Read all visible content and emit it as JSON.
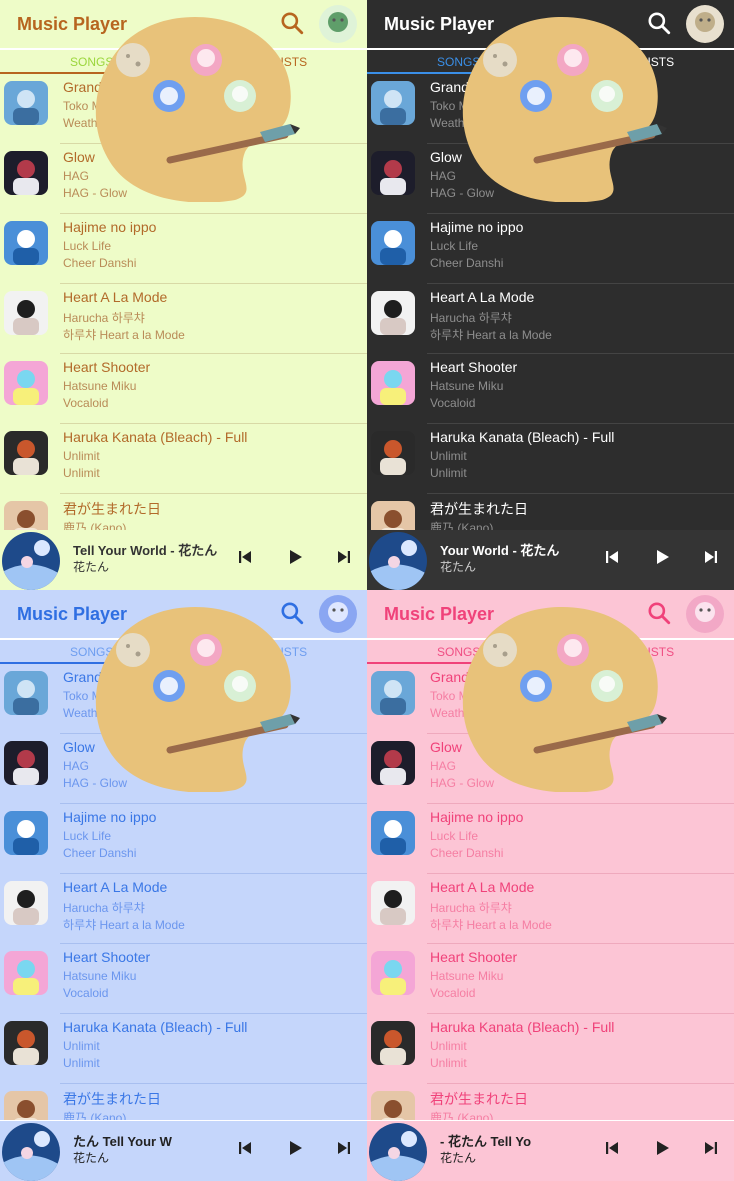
{
  "app": {
    "title": "Music Player",
    "tabs": {
      "songs": "SONGS",
      "playlists": "PLAYLISTS"
    }
  },
  "themes": [
    {
      "name": "green",
      "accent": "#b7651f",
      "background": "#eefcc8"
    },
    {
      "name": "dark",
      "accent": "#3a8fe8",
      "background": "#2d2d2d"
    },
    {
      "name": "blue",
      "accent": "#2f6fe2",
      "background": "#c5d6fb"
    },
    {
      "name": "pink",
      "accent": "#f0427a",
      "background": "#fcc5d5"
    }
  ],
  "songs": [
    {
      "title": "Grand Escape",
      "artist": "Toko Miura & RADWIMPS",
      "album": "Weathering With You - Grand Escape",
      "art": "anime-art"
    },
    {
      "title": "Glow",
      "artist": "HAG",
      "album": "HAG - Glow",
      "art": "anime-art"
    },
    {
      "title": "Hajime no ippo",
      "artist": "Luck Life",
      "album": "Cheer Danshi",
      "art": "sky-art"
    },
    {
      "title": "Heart A La Mode",
      "artist": "Harucha 하루챠",
      "album": "하루챠 Heart a la Mode",
      "art": "anime-art"
    },
    {
      "title": "Heart Shooter",
      "artist": "Hatsune Miku",
      "album": "Vocaloid",
      "art": "anime-art"
    },
    {
      "title": "Haruka Kanata (Bleach) - Full",
      "artist": "Unlimit",
      "album": "Unlimit",
      "art": "anime-art"
    },
    {
      "title": "君が生まれた日",
      "artist": "鹿乃 (Kano)",
      "album": "",
      "art": "anime-art"
    }
  ],
  "now_playing": {
    "panels": [
      {
        "title": "Tell Your World - 花たん",
        "artist": "花たん"
      },
      {
        "title": "Your World - 花たん",
        "artist": "花たん"
      },
      {
        "title": "たん          Tell Your W",
        "artist": "花たん"
      },
      {
        "title": "- 花たん        Tell Yo",
        "artist": "花たん"
      }
    ],
    "controls": {
      "prev": "skip-previous-icon",
      "play": "play-icon",
      "next": "skip-next-icon"
    }
  },
  "overlay": {
    "name": "theme-palette",
    "icon": "palette-icon"
  }
}
